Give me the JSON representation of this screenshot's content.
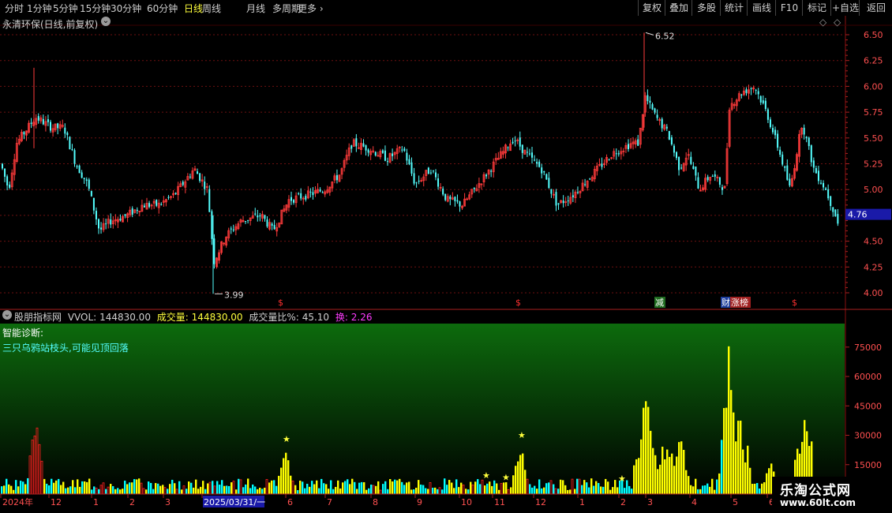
{
  "toolbar": {
    "periods": [
      "分时",
      "1分钟",
      "5分钟",
      "15分钟",
      "30分钟",
      "60分钟",
      "日线",
      "周线",
      "月线",
      "多周期",
      "更多"
    ],
    "active_period": "日线",
    "actions": [
      "复权",
      "叠加",
      "多股",
      "统计",
      "画线",
      "F10",
      "标记",
      "+自选",
      "返回"
    ]
  },
  "main_chart": {
    "title": "永清环保(日线,前复权)",
    "high_label": "6.52",
    "low_label": "3.99",
    "current_price": "4.76",
    "y_ticks": [
      "6.50",
      "6.25",
      "6.00",
      "5.75",
      "5.50",
      "5.25",
      "5.00",
      "4.75",
      "4.50",
      "4.25",
      "4.00"
    ],
    "markers": [
      "$",
      "$",
      "减",
      "财",
      "涨榜",
      "$"
    ],
    "colors": {
      "up": "#ff3b3b",
      "down": "#54ffff",
      "grid": "#7a1010",
      "price_tag_bg": "#1a1aa8"
    }
  },
  "indicator_panel": {
    "name": "股朋指标网",
    "vol_label": "VVOL:",
    "vol_value": "144830.00",
    "amount_label": "成交量:",
    "amount_value": "144830.00",
    "ratio_label": "成交量比%:",
    "ratio_value": "45.10",
    "turnover_label": "换:",
    "turnover_value": "2.26",
    "diagnosis_title": "智能诊断:",
    "diagnosis_text": "三只乌鸦站枝头,可能见顶回落",
    "y_ticks": [
      "75000",
      "60000",
      "45000",
      "30000",
      "15000"
    ],
    "colors": {
      "bar_yellow": "#ffff00",
      "bar_cyan": "#00ffff",
      "bar_red": "#ff2020",
      "bg_top": "#0d6b0d",
      "bg_bottom": "#000000"
    }
  },
  "x_axis": {
    "labels": [
      "2024年",
      "12",
      "1",
      "2",
      "3",
      "2025/03/31/一",
      "6",
      "7",
      "8",
      "9",
      "10",
      "11",
      "12",
      "1",
      "2",
      "3",
      "4",
      "5",
      "6"
    ]
  },
  "watermark": {
    "line1": "乐淘公式网",
    "line2": "www.60lt.com"
  }
}
